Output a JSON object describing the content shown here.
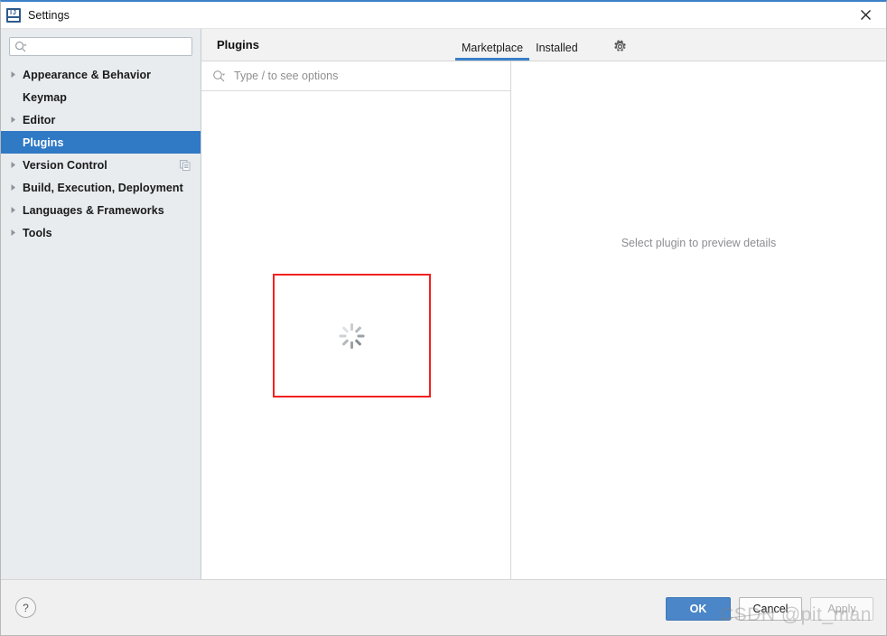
{
  "window": {
    "title": "Settings",
    "app_icon": "intellij-idea-icon",
    "close_icon": "close-icon"
  },
  "sidebar": {
    "search": {
      "value": "",
      "placeholder": "",
      "icon": "search-icon"
    },
    "items": [
      {
        "label": "Appearance & Behavior",
        "expandable": true,
        "selected": false,
        "trailing_icon": null
      },
      {
        "label": "Keymap",
        "expandable": false,
        "selected": false,
        "trailing_icon": null
      },
      {
        "label": "Editor",
        "expandable": true,
        "selected": false,
        "trailing_icon": null
      },
      {
        "label": "Plugins",
        "expandable": false,
        "selected": true,
        "trailing_icon": null
      },
      {
        "label": "Version Control",
        "expandable": true,
        "selected": false,
        "trailing_icon": "copy-icon"
      },
      {
        "label": "Build, Execution, Deployment",
        "expandable": true,
        "selected": false,
        "trailing_icon": null
      },
      {
        "label": "Languages & Frameworks",
        "expandable": true,
        "selected": false,
        "trailing_icon": null
      },
      {
        "label": "Tools",
        "expandable": true,
        "selected": false,
        "trailing_icon": null
      }
    ]
  },
  "main": {
    "title": "Plugins",
    "tabs": [
      {
        "label": "Marketplace",
        "active": true
      },
      {
        "label": "Installed",
        "active": false
      }
    ],
    "settings_icon": "gear-icon",
    "plugin_search": {
      "value": "",
      "placeholder": "Type / to see options",
      "icon": "search-icon"
    },
    "list": {
      "loading": true,
      "loading_icon": "spinner-icon",
      "annotation": {
        "shape": "rectangle",
        "color": "#f32020"
      }
    },
    "detail": {
      "placeholder": "Select plugin to preview details"
    }
  },
  "footer": {
    "help_label": "?",
    "help_icon": "help-icon",
    "buttons": [
      {
        "label": "OK",
        "style": "primary",
        "enabled": true
      },
      {
        "label": "Cancel",
        "style": "default",
        "enabled": true
      },
      {
        "label": "Apply",
        "style": "disabled",
        "enabled": false
      }
    ]
  },
  "watermark": {
    "source": "CSDN",
    "handle": "@pit_man"
  },
  "colors": {
    "accent": "#3a80c8",
    "selection": "#2f79c5",
    "primary_button": "#4a86c8",
    "annotation": "#f32020",
    "sidebar_bg": "#e8ecef",
    "titlebar_border": "#3a80c8"
  }
}
